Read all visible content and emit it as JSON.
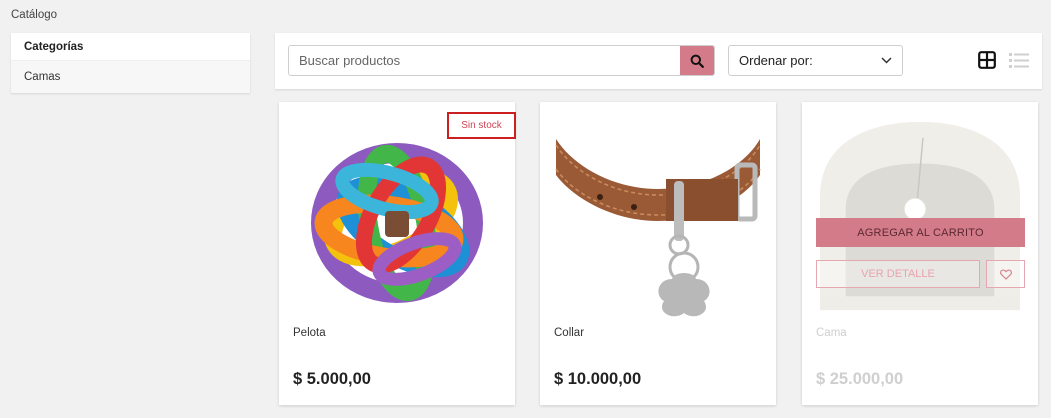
{
  "breadcrumb": "Catálogo",
  "sidebar": {
    "header": "Categorías",
    "items": [
      {
        "label": "Camas"
      }
    ]
  },
  "toolbar": {
    "search_placeholder": "Buscar productos",
    "sort_label": "Ordenar por:"
  },
  "products": [
    {
      "name": "Pelota",
      "price": "$ 5.000,00",
      "badge": "Sin stock"
    },
    {
      "name": "Collar",
      "price": "$ 10.000,00"
    },
    {
      "name": "Cama",
      "price": "$ 25.000,00",
      "add_to_cart": "AGREGAR AL CARRITO",
      "view_detail": "VER DETALLE"
    }
  ],
  "icons": {
    "search": "search-icon",
    "sort": "chevron-down-icon",
    "grid": "grid-view-icon",
    "list": "list-view-icon",
    "favorite": "heart-icon"
  },
  "colors": {
    "accent": "#d47b8a",
    "badge_border": "#cc1f1f",
    "background": "#f1f1f1"
  }
}
